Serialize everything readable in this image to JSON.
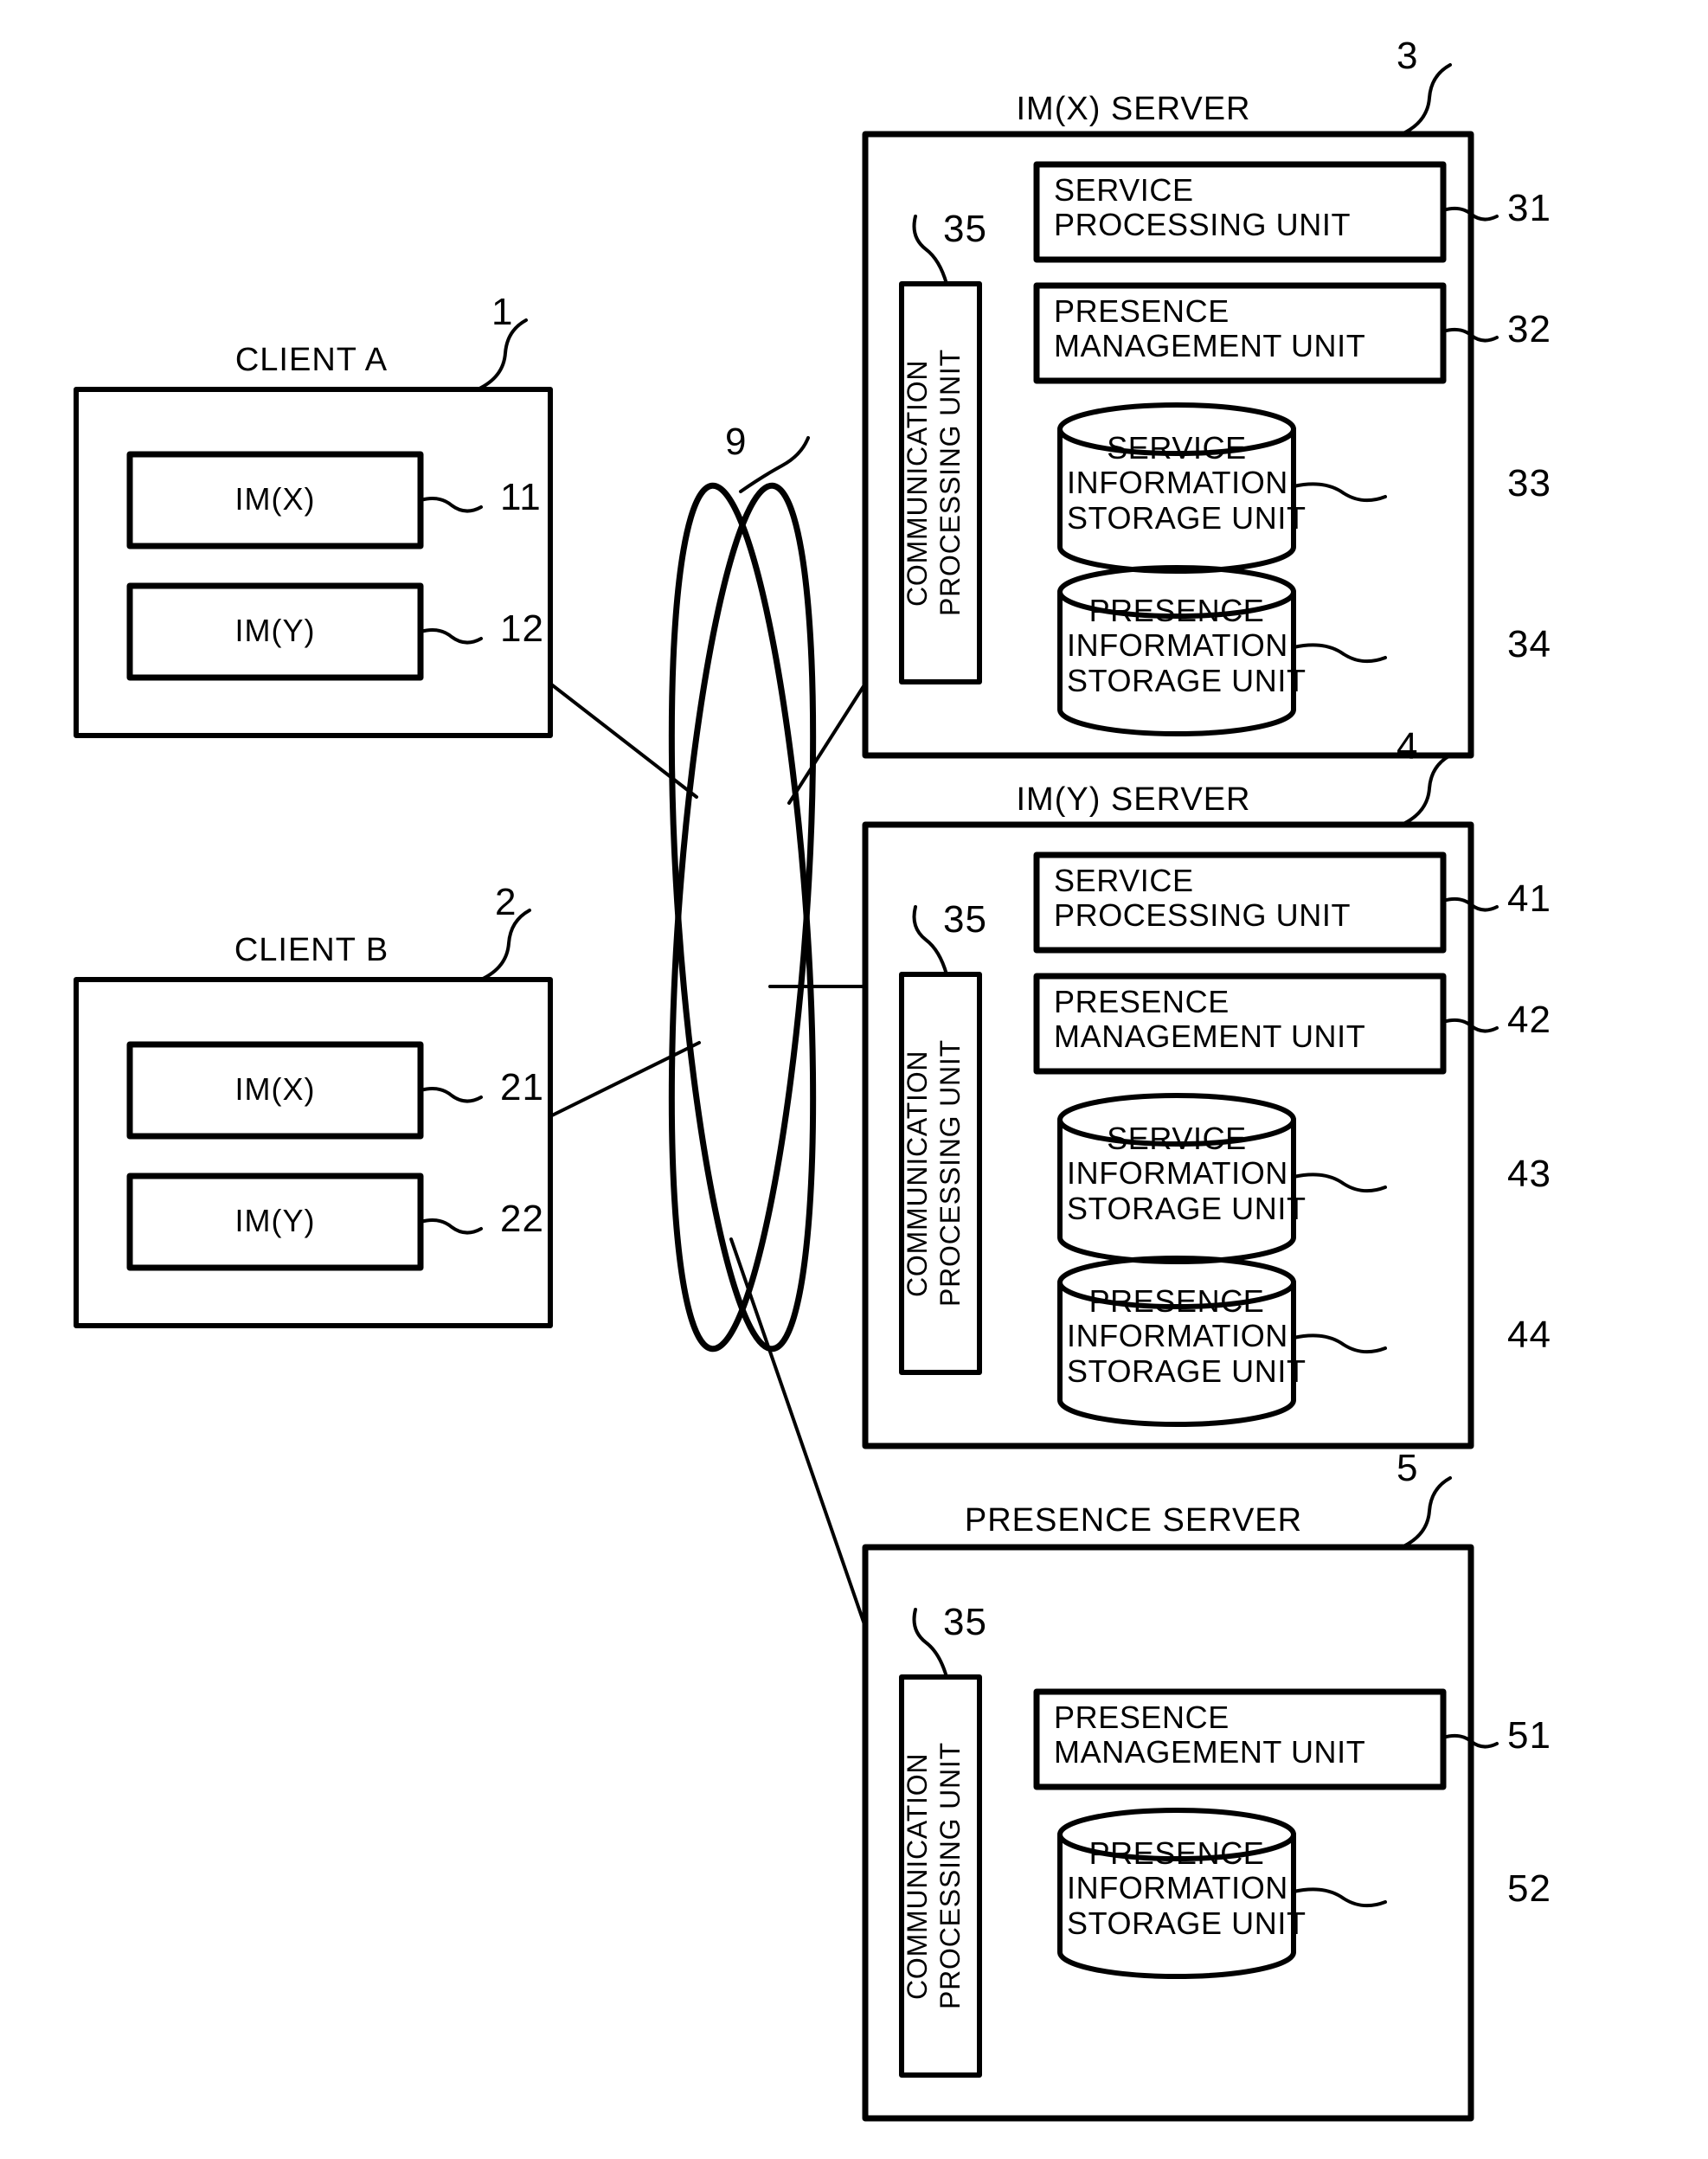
{
  "figure": {
    "type": "patent-block-diagram",
    "network": {
      "ref": "9",
      "name": "network-cloud"
    }
  },
  "clients": [
    {
      "name": "CLIENT A",
      "ref": "1",
      "modules": [
        {
          "label": "IM(X)",
          "ref": "11"
        },
        {
          "label": "IM(Y)",
          "ref": "12"
        }
      ]
    },
    {
      "name": "CLIENT B",
      "ref": "2",
      "modules": [
        {
          "label": "IM(X)",
          "ref": "21"
        },
        {
          "label": "IM(Y)",
          "ref": "22"
        }
      ]
    }
  ],
  "servers": [
    {
      "name": "IM(X) SERVER",
      "ref": "3",
      "comm_unit": {
        "label": "COMMUNICATION\nPROCESSING UNIT",
        "ref": "35"
      },
      "units": [
        {
          "label": "SERVICE\nPROCESSING UNIT",
          "ref": "31",
          "shape": "box"
        },
        {
          "label": "PRESENCE\nMANAGEMENT UNIT",
          "ref": "32",
          "shape": "box"
        },
        {
          "label": "SERVICE\nINFORMATION\nSTORAGE UNIT",
          "ref": "33",
          "shape": "cylinder"
        },
        {
          "label": "PRESENCE\nINFORMATION\nSTORAGE UNIT",
          "ref": "34",
          "shape": "cylinder"
        }
      ]
    },
    {
      "name": "IM(Y) SERVER",
      "ref": "4",
      "comm_unit": {
        "label": "COMMUNICATION\nPROCESSING UNIT",
        "ref": "35"
      },
      "units": [
        {
          "label": "SERVICE\nPROCESSING UNIT",
          "ref": "41",
          "shape": "box"
        },
        {
          "label": "PRESENCE\nMANAGEMENT UNIT",
          "ref": "42",
          "shape": "box"
        },
        {
          "label": "SERVICE\nINFORMATION\nSTORAGE UNIT",
          "ref": "43",
          "shape": "cylinder"
        },
        {
          "label": "PRESENCE\nINFORMATION\nSTORAGE UNIT",
          "ref": "44",
          "shape": "cylinder"
        }
      ]
    },
    {
      "name": "PRESENCE SERVER",
      "ref": "5",
      "comm_unit": {
        "label": "COMMUNICATION\nPROCESSING UNIT",
        "ref": "35"
      },
      "units": [
        {
          "label": "PRESENCE\nMANAGEMENT UNIT",
          "ref": "51",
          "shape": "box"
        },
        {
          "label": "PRESENCE\nINFORMATION\nSTORAGE UNIT",
          "ref": "52",
          "shape": "cylinder"
        }
      ]
    }
  ],
  "colors": {
    "ink": "#000000",
    "paper": "#ffffff"
  }
}
